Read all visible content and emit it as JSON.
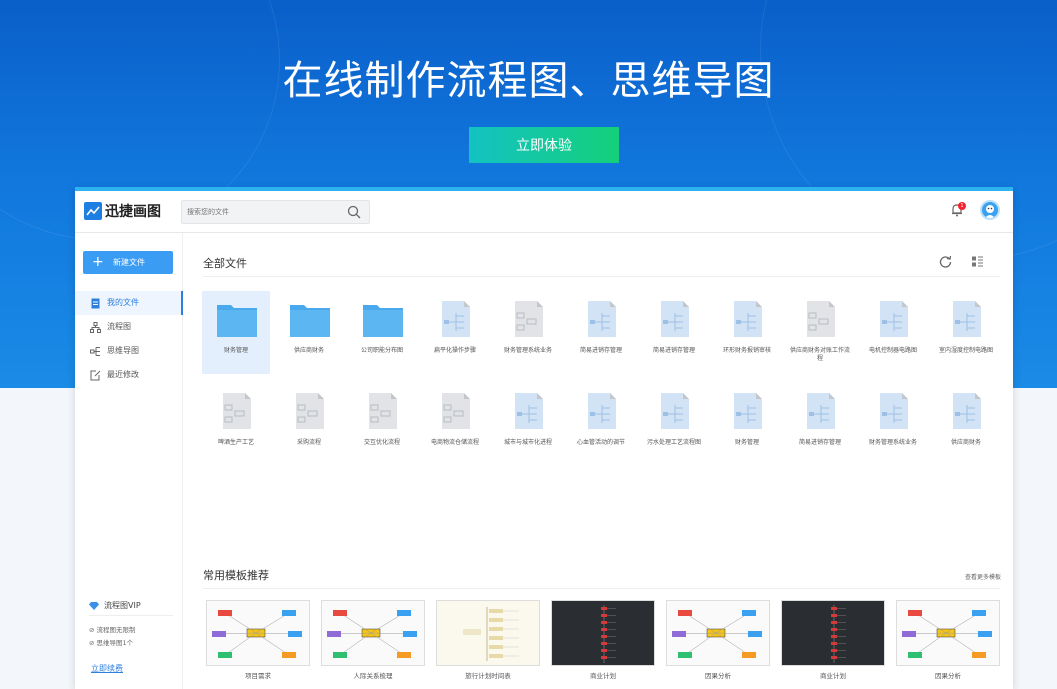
{
  "hero": {
    "title": "在线制作流程图、思维导图",
    "cta_label": "立即体验"
  },
  "app": {
    "logo_text": "迅捷画图",
    "search_placeholder": "搜索您的文件",
    "notification_count": "1",
    "sidebar": {
      "new_file_label": "新建文件",
      "nav": [
        {
          "label": "我的文件",
          "icon": "file-icon",
          "active": true
        },
        {
          "label": "流程图",
          "icon": "flowchart-icon",
          "active": false
        },
        {
          "label": "思维导图",
          "icon": "mindmap-icon",
          "active": false
        },
        {
          "label": "最近修改",
          "icon": "edit-icon",
          "active": false
        }
      ],
      "vip_title": "流程图VIP",
      "vip_features": [
        "流程图无限制",
        "思维导图1个"
      ],
      "renew_label": "立即续费"
    },
    "main": {
      "title": "全部文件",
      "files": [
        {
          "name": "财务管理",
          "kind": "folder",
          "selected": true
        },
        {
          "name": "供应商财务",
          "kind": "folder"
        },
        {
          "name": "公司职能分布图",
          "kind": "folder"
        },
        {
          "name": "扁平化操作步骤",
          "kind": "mindmap"
        },
        {
          "name": "财务管理系统业务",
          "kind": "flow"
        },
        {
          "name": "简易进销存管理",
          "kind": "mindmap"
        },
        {
          "name": "简易进销存管理",
          "kind": "mindmap"
        },
        {
          "name": "环形财务报销审核",
          "kind": "mindmap"
        },
        {
          "name": "供应商财务对账工作流程",
          "kind": "flow"
        },
        {
          "name": "电机控制器电路图",
          "kind": "mindmap"
        },
        {
          "name": "室内湿度控制电路图",
          "kind": "mindmap"
        },
        {
          "name": "啤酒生产工艺",
          "kind": "flow"
        },
        {
          "name": "采购流程",
          "kind": "flow"
        },
        {
          "name": "交互优化流程",
          "kind": "flow"
        },
        {
          "name": "电商物流仓储流程",
          "kind": "flow"
        },
        {
          "name": "城市与城市化进程",
          "kind": "mindmap"
        },
        {
          "name": "心血管活动的调节",
          "kind": "mindmap"
        },
        {
          "name": "污水处理工艺流程图",
          "kind": "mindmap"
        },
        {
          "name": "财务管理",
          "kind": "mindmap"
        },
        {
          "name": "简易进销存管理",
          "kind": "mindmap"
        },
        {
          "name": "财务管理系统业务",
          "kind": "mindmap"
        },
        {
          "name": "供应商财务",
          "kind": "mindmap"
        }
      ],
      "templates_title": "常用模板推荐",
      "templates_more": "查看更多模板",
      "templates": [
        {
          "name": "项目需求",
          "style": "light"
        },
        {
          "name": "人际关系梳理",
          "style": "light"
        },
        {
          "name": "旅行计划时间表",
          "style": "cream"
        },
        {
          "name": "商业计划",
          "style": "dark"
        },
        {
          "name": "因果分析",
          "style": "light"
        },
        {
          "name": "商业计划",
          "style": "dark"
        },
        {
          "name": "因果分析",
          "style": "light"
        }
      ]
    }
  },
  "colors": {
    "hero_blue": "#1177dd",
    "accent": "#2d7fdc",
    "cta_green": "#14d07a",
    "folder": "#4aa9ec"
  }
}
